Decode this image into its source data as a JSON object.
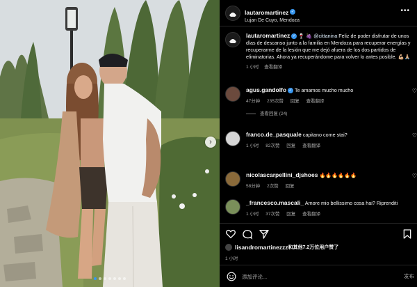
{
  "post": {
    "username": "lautaromartinez",
    "location": "Lujan De Cuyo, Mendoza",
    "caption_user": "lautaromartinez",
    "caption_emoji": "🍷 🍇",
    "caption_mention": "@cittanina",
    "caption_text": "Feliz de poder disfrutar de unos días de descanso junto a la familia en Mendoza para recuperar energías y recuperarme de la lesión que me dejó afuera de los dos partidos de eliminatorias. Ahora ya recuperándome para volver lo antes posible. 💪🏼🙏🏼",
    "caption_time": "1 小时",
    "caption_translate": "查看翻译",
    "photo_count": 7,
    "photo_index": 0
  },
  "comments": [
    {
      "user": "agus.gandolfo",
      "verified": true,
      "text": "Te amamos mucho mucho",
      "time": "47分钟",
      "likes": "235次赞",
      "reply": "回复",
      "translate": "查看翻译",
      "replies": "查看回复 (24)"
    },
    {
      "user": "franco.de_pasquale",
      "verified": false,
      "text": "capitano come stai?",
      "time": "1 小时",
      "likes": "82次赞",
      "reply": "回复",
      "translate": "查看翻译",
      "replies": ""
    },
    {
      "user": "nicolascarpellini_djshoes",
      "verified": false,
      "text": "🔥🔥🔥🔥🔥🔥",
      "time": "58分钟",
      "likes": "2次赞",
      "reply": "回复",
      "translate": "",
      "replies": ""
    },
    {
      "user": "_francesco.mascali_",
      "verified": false,
      "text": "Amore mio bellissimo cosa hai? Riprenditi",
      "time": "1 小时",
      "likes": "37次赞",
      "reply": "回复",
      "translate": "查看翻译",
      "replies": ""
    }
  ],
  "footer": {
    "likes_user": "lisandromartinezzz",
    "likes_text": "和其他7.2万位用户赞了",
    "time": "1 小时",
    "input_placeholder": "添加评论...",
    "post_button": "发布"
  },
  "icons": {
    "heart": "heart-icon",
    "comment": "comment-icon",
    "share": "share-icon",
    "save": "bookmark-icon",
    "next": "chevron-right-icon",
    "emoji": "emoji-icon",
    "more": "more-icon",
    "verified": "verified-badge-icon"
  },
  "colors": {
    "accent": "#3897f0",
    "background": "#000000",
    "muted": "#a8a8a8"
  }
}
